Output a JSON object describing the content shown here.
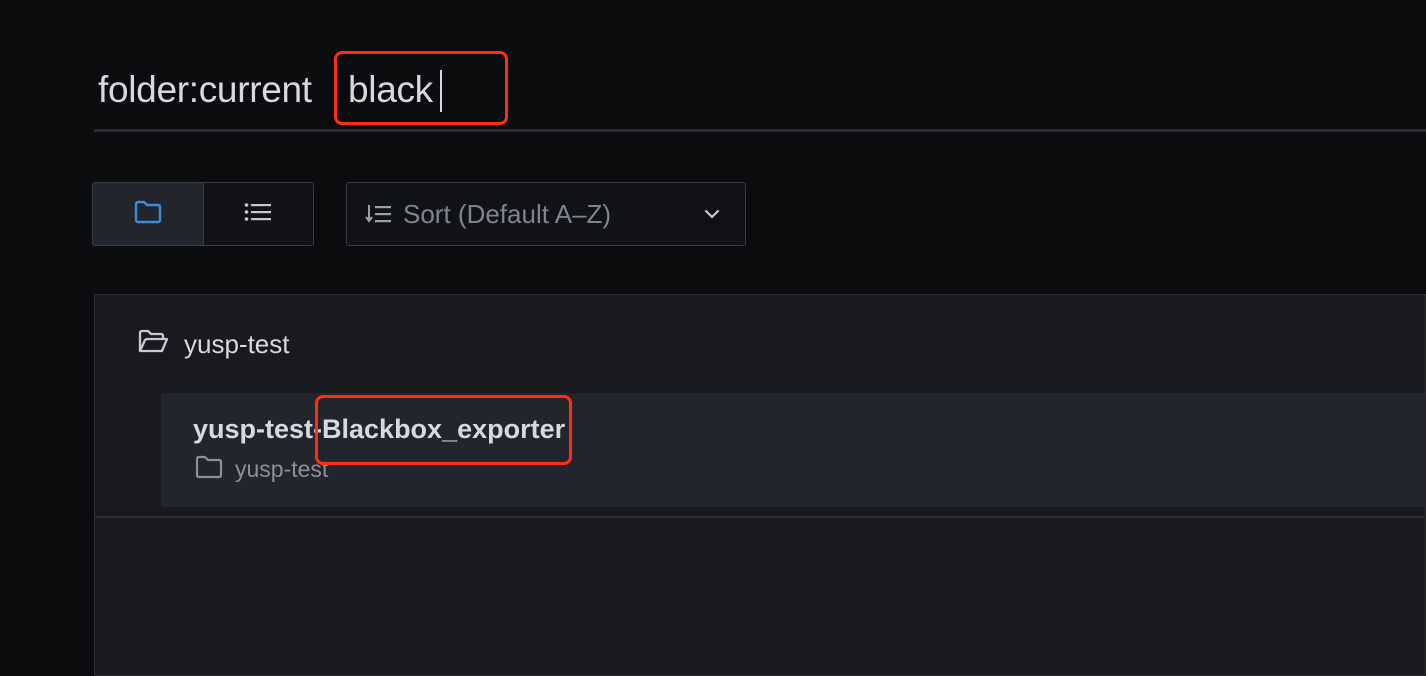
{
  "search": {
    "prefix": "folder:current",
    "query": "black"
  },
  "view_toggle": {
    "folder_view_icon": "folder-icon",
    "list_view_icon": "list-icon",
    "active": "folder"
  },
  "sort": {
    "icon": "sort-icon",
    "label": "Sort (Default A–Z)",
    "chevron_icon": "chevron-down-icon"
  },
  "results": {
    "folder": {
      "icon": "folder-open-icon",
      "name": "yusp-test"
    },
    "items": [
      {
        "title": "yusp-test-Blackbox_exporter",
        "folder_icon": "folder-icon",
        "folder_name": "yusp-test"
      }
    ]
  },
  "colors": {
    "background": "#0b0c0e",
    "panel": "#181a1f",
    "card": "#22252b",
    "accent_blue": "#3d8bd9",
    "annotation_red": "#ff2d12"
  }
}
